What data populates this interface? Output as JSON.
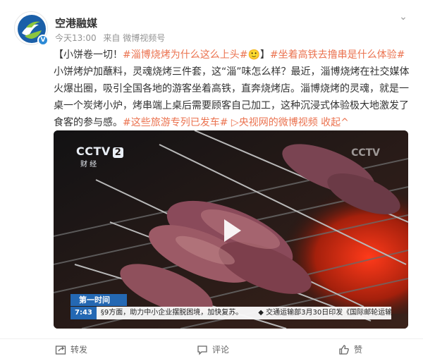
{
  "post": {
    "author": "空港融媒",
    "time": "今天13:00",
    "source": "来自 微博视频号",
    "verified_glyph": "V",
    "more_glyph": "⌄",
    "text": {
      "p1": "【小饼卷一切！",
      "tag1": "#淄博烧烤为什么这么上头#",
      "emoji": "🙂",
      "p2": "】",
      "tag2": "#坐着高铁去撸串是什么体验#",
      "p3": " 小饼烤炉加蘸料，灵魂烧烤三件套，这“淄”味怎么样？最近，淄博烧烤在社交媒体火爆出圈，吸引全国各地的游客坐着高铁，直奔烧烤店。淄博烧烤的灵魂，就是一桌一个炭烤小炉，烤串端上桌后需要顾客自己加工，这种沉浸式体验极大地激发了食客的参与感。",
      "tag3": "#这些旅游专列已发车#",
      "video_link": "▷央视网的微博视频",
      "collapse": "收起^"
    }
  },
  "video": {
    "logo_text": "CCTV",
    "logo_num": "2",
    "channel_sub": "财 经",
    "watermark": "CCTV",
    "lower_head": "第一时间",
    "lower_time": "7:43",
    "ticker1": "§9方面，助力中小企业摆脱困境，加快复苏。",
    "ticker2": "◆ 交通运输部3月30日印发《国际邮轮运输有"
  },
  "actions": {
    "repost": "转发",
    "comment": "评论",
    "like": "赞"
  },
  "colors": {
    "link": "#eb7350",
    "cctv_blue": "#2468b3",
    "avatar_blue": "#1b5fa8",
    "avatar_green": "#8cc63f"
  }
}
